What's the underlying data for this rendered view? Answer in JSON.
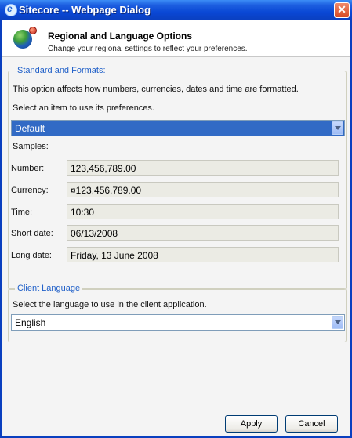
{
  "window": {
    "title": "Sitecore -- Webpage Dialog",
    "close_glyph": "✕",
    "browser_icon_glyph": "e"
  },
  "header": {
    "title": "Regional and Language Options",
    "subtitle": "Change your regional settings to reflect your preferences."
  },
  "standards": {
    "legend": "Standard and Formats:",
    "description": "This option affects how numbers, currencies, dates and time are formatted.",
    "select_prompt": "Select an item to use its preferences.",
    "selected_value": "Default",
    "samples_label": "Samples:",
    "samples": {
      "number": {
        "label": "Number:",
        "value": "123,456,789.00"
      },
      "currency": {
        "label": "Currency:",
        "value": "¤123,456,789.00"
      },
      "time": {
        "label": "Time:",
        "value": "10:30"
      },
      "short_date": {
        "label": "Short date:",
        "value": "06/13/2008"
      },
      "long_date": {
        "label": "Long date:",
        "value": "Friday, 13 June 2008"
      }
    }
  },
  "client_language": {
    "legend": "Client Language",
    "description": "Select the language to use in the client application.",
    "selected_value": "English"
  },
  "buttons": {
    "apply": "Apply",
    "cancel": "Cancel"
  },
  "colors": {
    "titlebar": "#0a47d5",
    "accent_selection": "#316ac5",
    "legend_text": "#1f5fc8",
    "close_button": "#d84a24"
  }
}
